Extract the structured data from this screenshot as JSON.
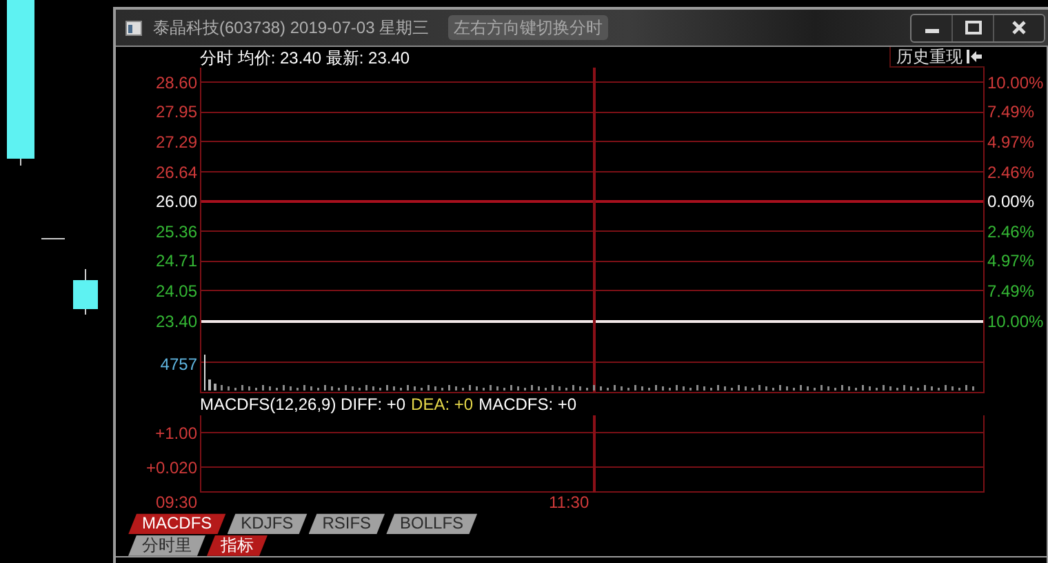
{
  "window": {
    "title": "泰晶科技(603738) 2019-07-03 星期三",
    "hint": "左右方向键切换分时"
  },
  "header": {
    "summary": "分时 均价: 23.40 最新: 23.40",
    "history_button": "历史重现"
  },
  "price_axis": [
    {
      "price": "28.60",
      "percent": "10.00%",
      "kind": "up"
    },
    {
      "price": "27.95",
      "percent": "7.49%",
      "kind": "up"
    },
    {
      "price": "27.29",
      "percent": "4.97%",
      "kind": "up"
    },
    {
      "price": "26.64",
      "percent": "2.46%",
      "kind": "up"
    },
    {
      "price": "26.00",
      "percent": "0.00%",
      "kind": "flat"
    },
    {
      "price": "25.36",
      "percent": "2.46%",
      "kind": "down"
    },
    {
      "price": "24.71",
      "percent": "4.97%",
      "kind": "down"
    },
    {
      "price": "24.05",
      "percent": "7.49%",
      "kind": "down"
    },
    {
      "price": "23.40",
      "percent": "10.00%",
      "kind": "down"
    }
  ],
  "volume_axis": "4757",
  "indicator": {
    "readouts": [
      {
        "text": "MACDFS(12,26,9) DIFF: +0",
        "color": "#ffffff"
      },
      {
        "text": "DEA: +0",
        "color": "#e6d84a"
      },
      {
        "text": "MACDFS: +0",
        "color": "#ffffff"
      }
    ],
    "axis": [
      "+1.00",
      "+0.020"
    ]
  },
  "time_axis": [
    "09:30",
    "11:30"
  ],
  "indicator_tabs": [
    {
      "label": "MACDFS",
      "selected": true
    },
    {
      "label": "KDJFS",
      "selected": false
    },
    {
      "label": "RSIFS",
      "selected": false
    },
    {
      "label": "BOLLFS",
      "selected": false
    }
  ],
  "view_tabs": [
    {
      "label": "分时里",
      "selected": false
    },
    {
      "label": "指标",
      "selected": true
    }
  ]
}
